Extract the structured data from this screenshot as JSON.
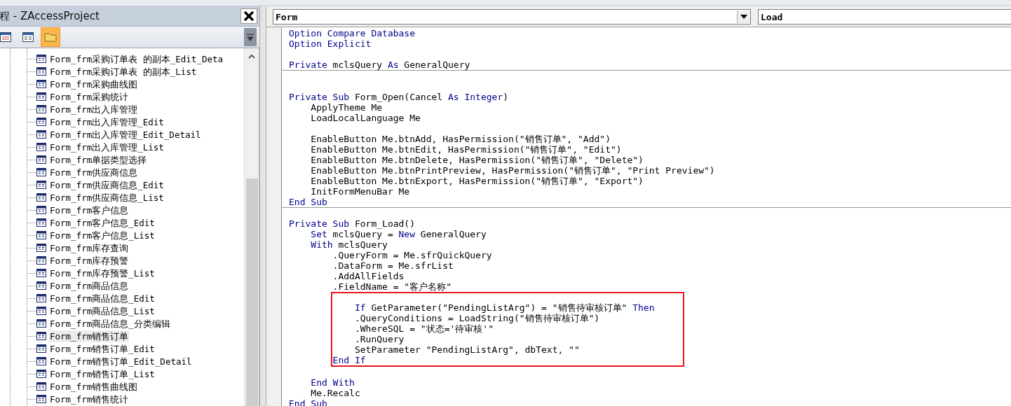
{
  "project_panel": {
    "title": "程 - ZAccessProject",
    "toolbar": [
      {
        "kind": "view-code",
        "selected": false
      },
      {
        "kind": "view-object",
        "selected": false
      },
      {
        "kind": "toggle-folders",
        "selected": true
      }
    ],
    "tree_items": [
      {
        "label": "Form_frm采购订单表 的副本_Edit_Deta",
        "selected": false
      },
      {
        "label": "Form_frm采购订单表 的副本_List",
        "selected": false
      },
      {
        "label": "Form_frm采购曲线图",
        "selected": false
      },
      {
        "label": "Form_frm采购统计",
        "selected": false
      },
      {
        "label": "Form_frm出入库管理",
        "selected": false
      },
      {
        "label": "Form_frm出入库管理_Edit",
        "selected": false
      },
      {
        "label": "Form_frm出入库管理_Edit_Detail",
        "selected": false
      },
      {
        "label": "Form_frm出入库管理_List",
        "selected": false
      },
      {
        "label": "Form_frm单据类型选择",
        "selected": false
      },
      {
        "label": "Form_frm供应商信息",
        "selected": false
      },
      {
        "label": "Form_frm供应商信息_Edit",
        "selected": false
      },
      {
        "label": "Form_frm供应商信息_List",
        "selected": false
      },
      {
        "label": "Form_frm客户信息",
        "selected": false
      },
      {
        "label": "Form_frm客户信息_Edit",
        "selected": false
      },
      {
        "label": "Form_frm客户信息_List",
        "selected": false
      },
      {
        "label": "Form_frm库存查询",
        "selected": false
      },
      {
        "label": "Form_frm库存预警",
        "selected": false
      },
      {
        "label": "Form_frm库存预警_List",
        "selected": false
      },
      {
        "label": "Form_frm商品信息",
        "selected": false
      },
      {
        "label": "Form_frm商品信息_Edit",
        "selected": false
      },
      {
        "label": "Form_frm商品信息_List",
        "selected": false
      },
      {
        "label": "Form_frm商品信息_分类编辑",
        "selected": false
      },
      {
        "label": "Form_frm销售订单",
        "selected": true
      },
      {
        "label": "Form_frm销售订单_Edit",
        "selected": false
      },
      {
        "label": "Form_frm销售订单_Edit_Detail",
        "selected": false
      },
      {
        "label": "Form_frm销售订单_List",
        "selected": false
      },
      {
        "label": "Form_frm销售曲线图",
        "selected": false
      },
      {
        "label": "Form_frm销售统计",
        "selected": false
      }
    ]
  },
  "code_window": {
    "object_box": "Form",
    "procedure_box": "Load",
    "sections": [
      {
        "items": [
          {
            "kind": "line",
            "segments": [
              {
                "text": "Option Compare Database",
                "kind": "keyword"
              }
            ]
          },
          {
            "kind": "line",
            "segments": [
              {
                "text": "Option Explicit",
                "kind": "keyword"
              }
            ]
          },
          {
            "kind": "blank"
          },
          {
            "kind": "line",
            "segments": [
              {
                "text": "Private",
                "kind": "keyword"
              },
              {
                "text": " mclsQuery ",
                "kind": "plain"
              },
              {
                "text": "As",
                "kind": "keyword"
              },
              {
                "text": " GeneralQuery",
                "kind": "plain"
              }
            ]
          }
        ]
      },
      {
        "items": [
          {
            "kind": "blank"
          },
          {
            "kind": "blank"
          },
          {
            "kind": "line",
            "segments": [
              {
                "text": "Private Sub",
                "kind": "keyword"
              },
              {
                "text": " Form_Open(Cancel ",
                "kind": "plain"
              },
              {
                "text": "As Integer",
                "kind": "keyword"
              },
              {
                "text": ")",
                "kind": "plain"
              }
            ]
          },
          {
            "kind": "line",
            "segments": [
              {
                "text": "    ApplyTheme Me",
                "kind": "plain"
              }
            ]
          },
          {
            "kind": "line",
            "segments": [
              {
                "text": "    LoadLocalLanguage Me",
                "kind": "plain"
              }
            ]
          },
          {
            "kind": "blank"
          },
          {
            "kind": "line",
            "segments": [
              {
                "text": "    EnableButton Me.btnAdd, HasPermission(\"销售订单\", \"Add\")",
                "kind": "plain"
              }
            ]
          },
          {
            "kind": "line",
            "segments": [
              {
                "text": "    EnableButton Me.btnEdit, HasPermission(\"销售订单\", \"Edit\")",
                "kind": "plain"
              }
            ]
          },
          {
            "kind": "line",
            "segments": [
              {
                "text": "    EnableButton Me.btnDelete, HasPermission(\"销售订单\", \"Delete\")",
                "kind": "plain"
              }
            ]
          },
          {
            "kind": "line",
            "segments": [
              {
                "text": "    EnableButton Me.btnPrintPreview, HasPermission(\"销售订单\", \"Print Preview\")",
                "kind": "plain"
              }
            ]
          },
          {
            "kind": "line",
            "segments": [
              {
                "text": "    EnableButton Me.btnExport, HasPermission(\"销售订单\", \"Export\")",
                "kind": "plain"
              }
            ]
          },
          {
            "kind": "line",
            "segments": [
              {
                "text": "    InitFormMenuBar Me",
                "kind": "plain"
              }
            ]
          },
          {
            "kind": "line",
            "segments": [
              {
                "text": "End Sub",
                "kind": "keyword"
              }
            ]
          }
        ]
      },
      {
        "items": [
          {
            "kind": "blank"
          },
          {
            "kind": "line",
            "segments": [
              {
                "text": "Private Sub",
                "kind": "keyword"
              },
              {
                "text": " Form_Load()",
                "kind": "plain"
              }
            ]
          },
          {
            "kind": "line",
            "segments": [
              {
                "text": "    Set",
                "kind": "keyword"
              },
              {
                "text": " mclsQuery = ",
                "kind": "plain"
              },
              {
                "text": "New",
                "kind": "keyword"
              },
              {
                "text": " GeneralQuery",
                "kind": "plain"
              }
            ]
          },
          {
            "kind": "line",
            "segments": [
              {
                "text": "    With",
                "kind": "keyword"
              },
              {
                "text": " mclsQuery",
                "kind": "plain"
              }
            ]
          },
          {
            "kind": "line",
            "segments": [
              {
                "text": "        .QueryForm = Me.sfrQuickQuery",
                "kind": "plain"
              }
            ]
          },
          {
            "kind": "line",
            "segments": [
              {
                "text": "        .DataForm = Me.sfrList",
                "kind": "plain"
              }
            ]
          },
          {
            "kind": "line",
            "segments": [
              {
                "text": "        .AddAllFields",
                "kind": "plain"
              }
            ]
          },
          {
            "kind": "line",
            "segments": [
              {
                "text": "        .FieldName = \"客户名称\"",
                "kind": "plain"
              }
            ]
          },
          {
            "kind": "highlight",
            "lines": [
              {
                "kind": "blank"
              },
              {
                "kind": "line",
                "segments": [
                  {
                    "text": "            If",
                    "kind": "keyword"
                  },
                  {
                    "text": " GetParameter(\"PendingListArg\") = \"销售待审核订单\" ",
                    "kind": "plain"
                  },
                  {
                    "text": "Then",
                    "kind": "keyword"
                  }
                ]
              },
              {
                "kind": "line",
                "segments": [
                  {
                    "text": "            .QueryConditions = LoadString(\"销售待审核订单\")",
                    "kind": "plain"
                  }
                ]
              },
              {
                "kind": "line",
                "segments": [
                  {
                    "text": "            .WhereSQL = \"状态='待审核'\"",
                    "kind": "plain"
                  }
                ]
              },
              {
                "kind": "line",
                "segments": [
                  {
                    "text": "            .RunQuery",
                    "kind": "plain"
                  }
                ]
              },
              {
                "kind": "line",
                "segments": [
                  {
                    "text": "            SetParameter \"PendingListArg\", dbText, \"\"",
                    "kind": "plain"
                  }
                ]
              },
              {
                "kind": "line",
                "segments": [
                  {
                    "text": "        End If",
                    "kind": "keyword"
                  }
                ]
              }
            ]
          },
          {
            "kind": "blank"
          },
          {
            "kind": "line",
            "segments": [
              {
                "text": "    End With",
                "kind": "keyword"
              }
            ]
          },
          {
            "kind": "line",
            "segments": [
              {
                "text": "    Me.Recalc",
                "kind": "plain"
              }
            ]
          },
          {
            "kind": "line",
            "segments": [
              {
                "text": "End Sub",
                "kind": "keyword"
              }
            ]
          }
        ]
      }
    ]
  }
}
